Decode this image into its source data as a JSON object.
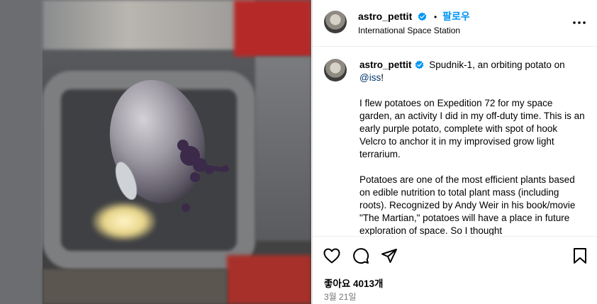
{
  "post": {
    "image_alt": "",
    "header": {
      "username": "astro_pettit",
      "separator": "•",
      "follow_label": "팔로우",
      "location": "International Space Station"
    },
    "caption": {
      "username": "astro_pettit",
      "intro_text": "Spudnik-1, an orbiting potato on",
      "mention": "@iss",
      "intro_end": "!",
      "paragraph_1": "I flew potatoes on Expedition 72 for my space garden, an activity I did in my off-duty time. This is an early purple potato, complete with spot of hook Velcro to anchor it in my improvised grow light terrarium.",
      "paragraph_2": "Potatoes are one of the most efficient plants based on edible nutrition to total plant mass (including roots). Recognized by Andy Weir in his book/movie \"The Martian,\" potatoes will have a place in future exploration of space. So I thought"
    },
    "actions": {
      "like_icon": "heart-icon",
      "comment_icon": "comment-icon",
      "share_icon": "send-icon",
      "save_icon": "bookmark-icon"
    },
    "likes_label": "좋아요 4013개",
    "date_label": "3월 21일"
  },
  "colors": {
    "follow": "#0095f6",
    "mention": "#00376b",
    "verified": "#0095f6",
    "secondary_text": "#737373"
  }
}
